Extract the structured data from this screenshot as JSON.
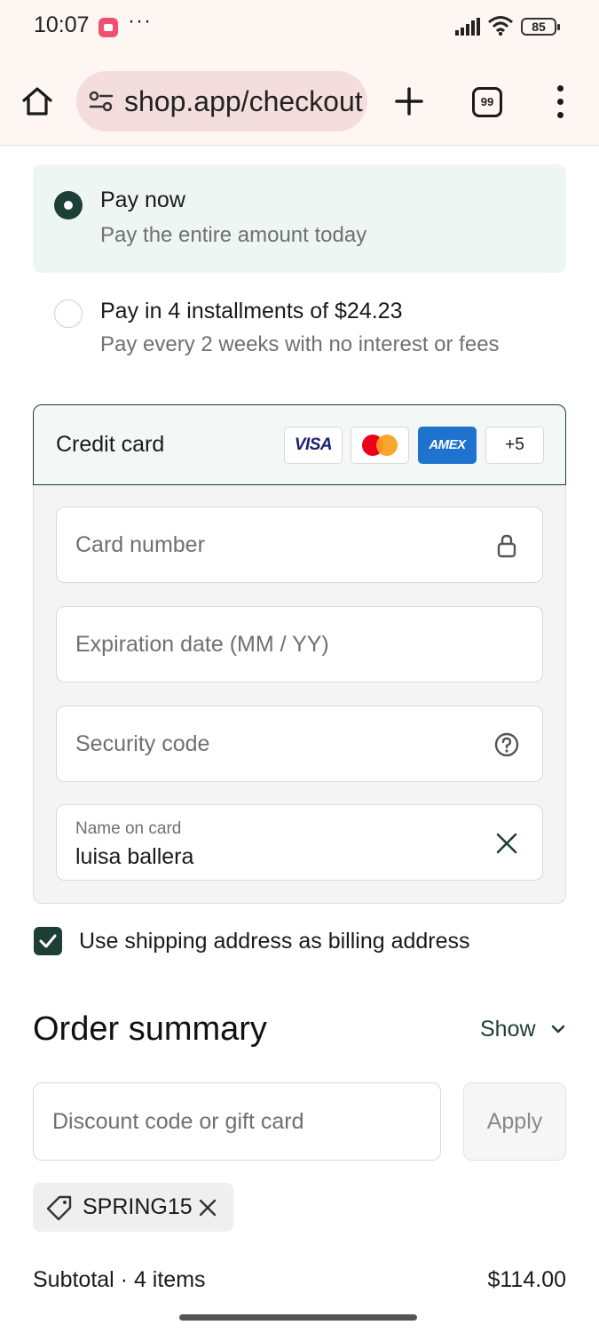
{
  "status_bar": {
    "time": "10:07",
    "more": "···",
    "battery": "85",
    "icons": [
      "app-notification-icon",
      "signal-icon",
      "wifi-icon",
      "battery-icon"
    ]
  },
  "browser": {
    "url": "shop.app/checkout",
    "tab_count": "99",
    "icons": [
      "home-icon",
      "site-settings-icon",
      "plus-icon",
      "tabs-icon",
      "more-vert-icon"
    ]
  },
  "payment_options": {
    "pay_now": {
      "title": "Pay now",
      "subtitle": "Pay the entire amount today",
      "selected": true
    },
    "installments": {
      "title": "Pay in 4 installments of $24.23",
      "subtitle": "Pay every 2 weeks with no interest or fees",
      "selected": false
    }
  },
  "credit_card": {
    "title": "Credit card",
    "logos": {
      "visa": "VISA",
      "amex": "AMEX",
      "more": "+5"
    },
    "fields": {
      "card_number": {
        "placeholder": "Card number",
        "icon": "lock-icon"
      },
      "expiration": {
        "placeholder": "Expiration date (MM / YY)"
      },
      "security_code": {
        "placeholder": "Security code",
        "icon": "help-circle-icon"
      },
      "name_on_card": {
        "label": "Name on card",
        "value": "luisa ballera",
        "icon": "clear-icon"
      }
    }
  },
  "billing": {
    "label": "Use shipping address as billing address",
    "checked": true
  },
  "order_summary": {
    "title": "Order summary",
    "toggle": "Show",
    "discount_placeholder": "Discount code or gift card",
    "apply": "Apply",
    "applied_code": "SPRING15",
    "subtotal_label": "Subtotal · 4 items",
    "subtotal_value": "$114.00"
  },
  "colors": {
    "accent": "#1d3f35",
    "selected_bg": "#eef6f3",
    "browser_bg": "#fdf6f3",
    "url_pill": "#f4dedd"
  }
}
